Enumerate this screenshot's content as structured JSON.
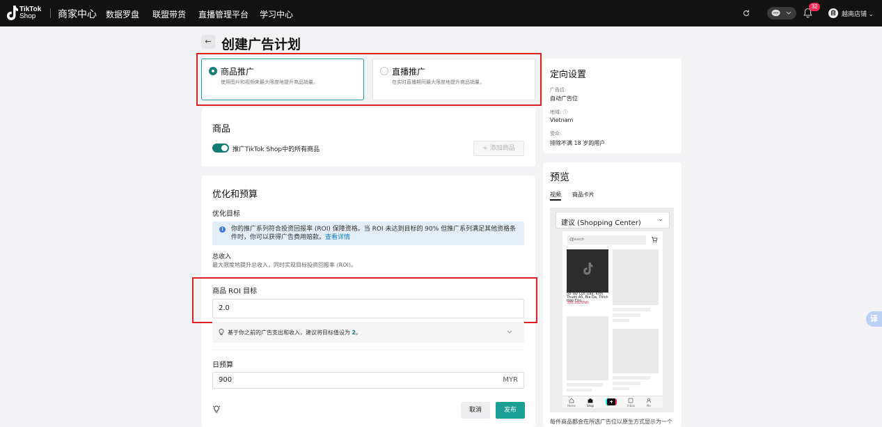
{
  "topbar": {
    "logo_text_line1": "TikTok",
    "logo_text_line2": "Shop",
    "brand": "商家中心",
    "nav": [
      "数据罗盘",
      "联盟带货",
      "直播管理平台",
      "学习中心"
    ],
    "notification_count": "32",
    "avatar_letter": "自",
    "shop_name": "越南店铺"
  },
  "page": {
    "title": "创建广告计划"
  },
  "promo_types": [
    {
      "title": "商品推广",
      "desc": "使用图片和视频来最大限度地提升商品销量。",
      "selected": true
    },
    {
      "title": "直播推广",
      "desc": "在实时直播期间最大限度地提升商品销量。",
      "selected": false
    }
  ],
  "products": {
    "title": "商品",
    "toggle_label": "推广TikTok Shop中的所有商品",
    "toggle_on": true,
    "add_button": "+ 添加商品"
  },
  "optimize": {
    "title": "优化和预算",
    "goal_label": "优化目标",
    "info_text": "你的推广系列符合投资回报率 (ROI) 保障资格。当 ROI 未达到目标的 90% 但推广系列满足其他资格条件时，你可以获得广告费用赔款。",
    "info_link": "查看详情",
    "revenue_title": "总收入",
    "revenue_desc": "最大限度地提升总收入，同时实现目标投资回报率 (ROI)。",
    "roi_label": "商品 ROI 目标",
    "roi_value": "2.0",
    "suggestion_prefix": "基于你之前的广告支出和收入，建议将目标值设为 ",
    "suggestion_value": "2",
    "suggestion_suffix": "。",
    "budget_label": "日预算",
    "budget_value": "900",
    "budget_currency": "MYR"
  },
  "actions": {
    "cancel": "取消",
    "publish": "发布"
  },
  "targeting": {
    "title": "定向设置",
    "placement_key": "广告位:",
    "placement_val": "自动广告位",
    "region_key": "地域:",
    "region_val": "Vietnam",
    "audience_key": "受众:",
    "audience_val": "排除不满 18 岁的用户"
  },
  "preview": {
    "title": "预览",
    "tabs": [
      "视频",
      "商品卡片"
    ],
    "placement_select": "建议 (Shopping Center)",
    "search_placeholder": "Search",
    "product_title": "Sổ Tay Cực Dày, Kích Thước A5, Bìa Da, Thích Hợp Cho...",
    "product_price": "350,392VND",
    "bottom_nav": [
      "Home",
      "Shop",
      "",
      "Inbox",
      "Me"
    ],
    "footer_note": "每件商品都会在所选广告位以原生方式显示为一个"
  },
  "floating_button": "译",
  "colors": {
    "accent": "#0f7c76",
    "publish": "#1b9e96",
    "highlight": "#e02020",
    "badge": "#fe2c55"
  }
}
